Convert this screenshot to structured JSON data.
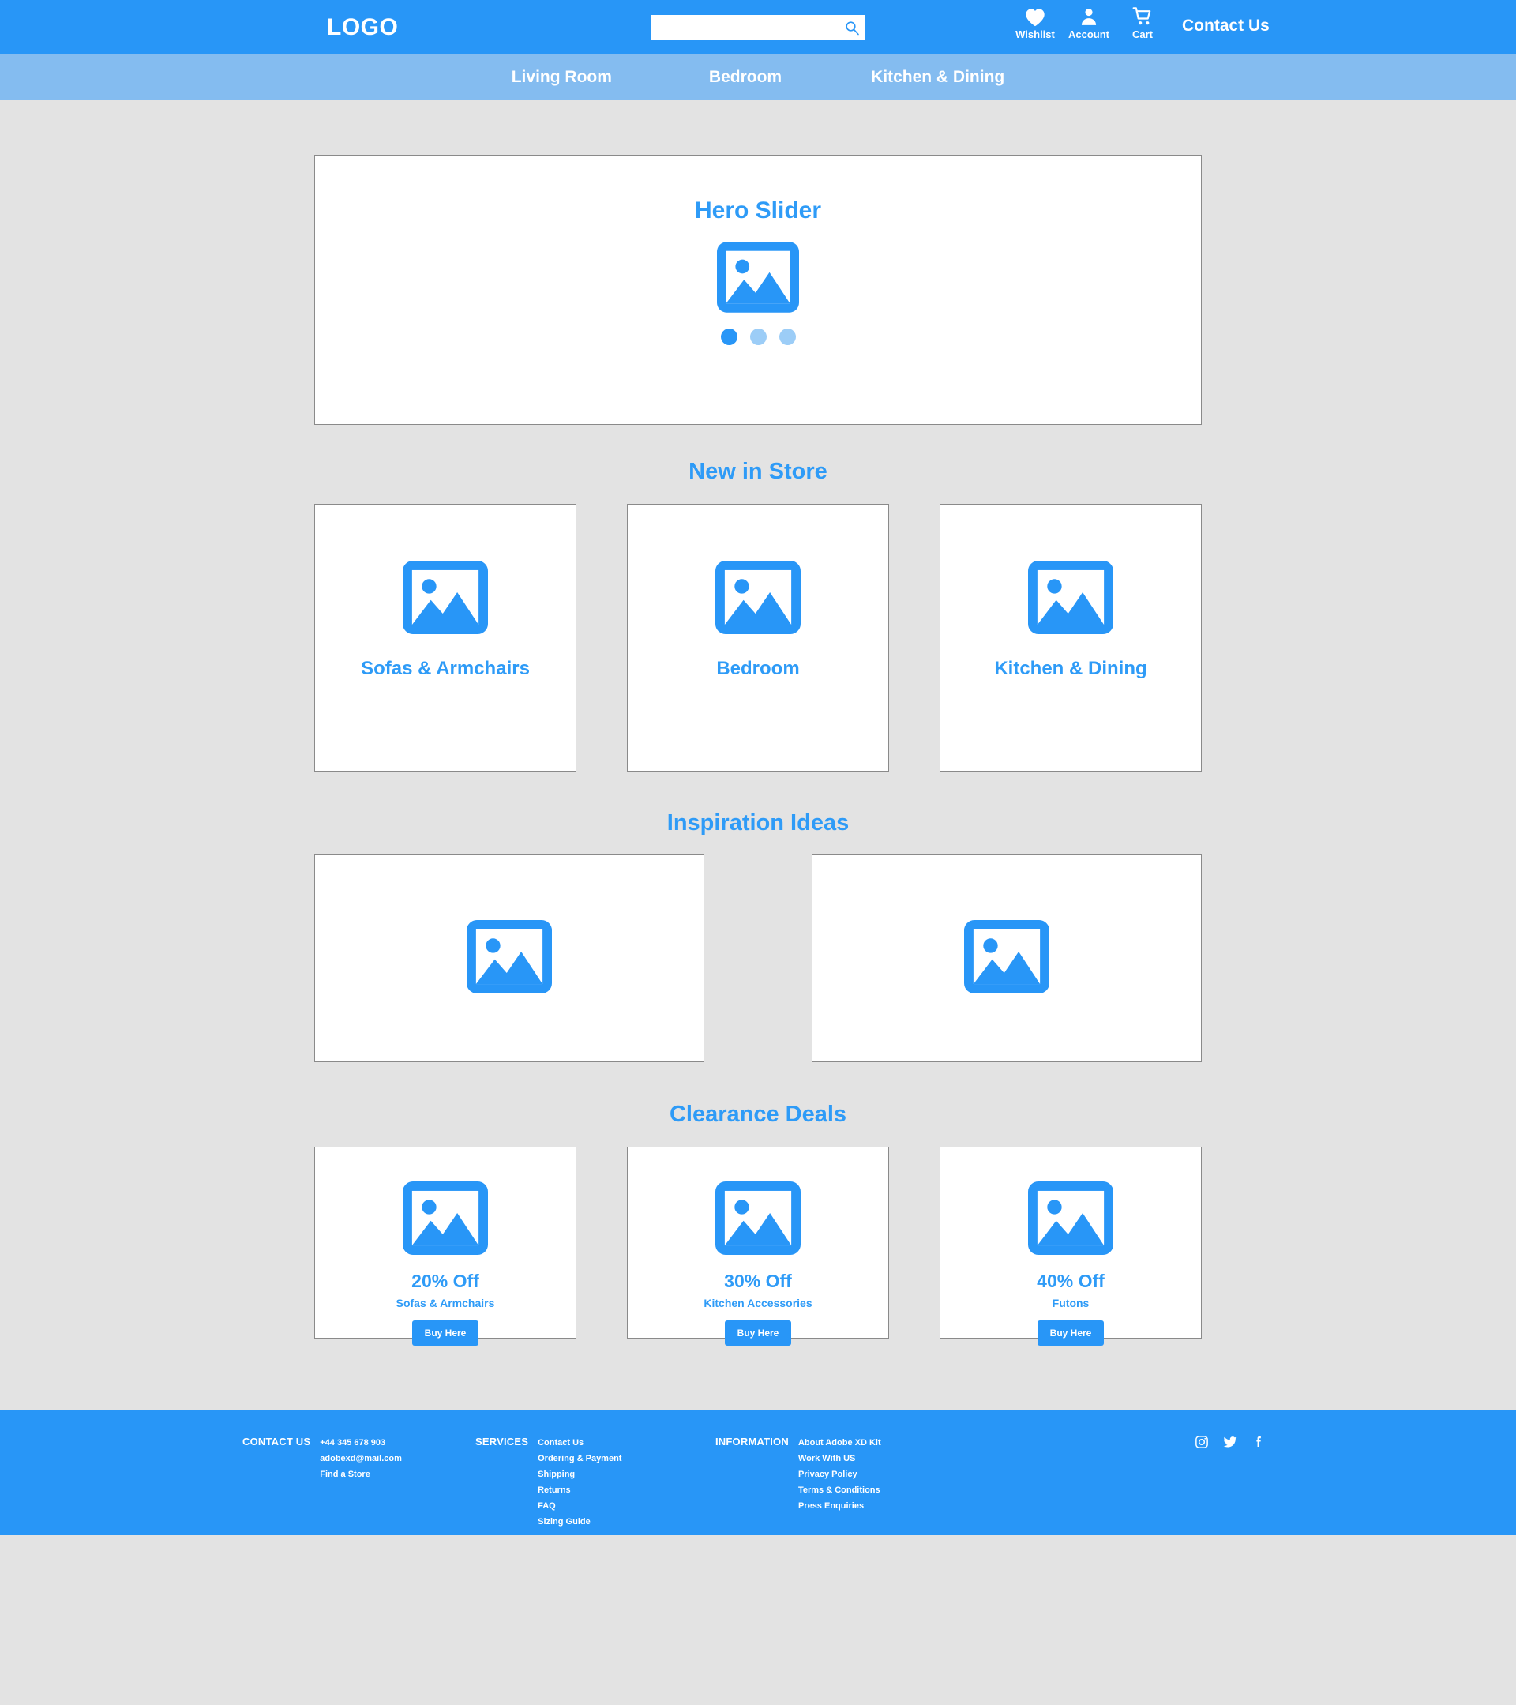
{
  "header": {
    "logo": "LOGO",
    "search": {
      "value": "",
      "placeholder": ""
    },
    "actions": [
      {
        "icon": "heart-icon",
        "label": "Wishlist"
      },
      {
        "icon": "person-icon",
        "label": "Account"
      },
      {
        "icon": "cart-icon",
        "label": "Cart"
      }
    ],
    "contact_label": "Contact Us"
  },
  "nav": {
    "items": [
      {
        "label": "Living Room"
      },
      {
        "label": "Bedroom"
      },
      {
        "label": "Kitchen & Dining"
      }
    ]
  },
  "hero": {
    "title": "Hero Slider",
    "image_icon": "image-placeholder-icon",
    "dots": [
      {
        "active": true
      },
      {
        "active": false
      },
      {
        "active": false
      }
    ]
  },
  "new_in_store": {
    "title": "New in Store",
    "cards": [
      {
        "label": "Sofas & Armchairs",
        "icon": "image-placeholder-icon"
      },
      {
        "label": "Bedroom",
        "icon": "image-placeholder-icon"
      },
      {
        "label": "Kitchen & Dining",
        "icon": "image-placeholder-icon"
      }
    ]
  },
  "inspiration": {
    "title": "Inspiration Ideas",
    "cards": [
      {
        "icon": "image-placeholder-icon"
      },
      {
        "icon": "image-placeholder-icon"
      }
    ]
  },
  "clearance": {
    "title": "Clearance Deals",
    "cards": [
      {
        "percent": "20% Off",
        "category": "Sofas & Armchairs",
        "button": "Buy Here",
        "icon": "image-placeholder-icon"
      },
      {
        "percent": "30% Off",
        "category": "Kitchen Accessories",
        "button": "Buy Here",
        "icon": "image-placeholder-icon"
      },
      {
        "percent": "40% Off",
        "category": "Futons",
        "button": "Buy Here",
        "icon": "image-placeholder-icon"
      }
    ]
  },
  "footer": {
    "contact": {
      "heading": "CONTACT US",
      "items": [
        "+44 345 678 903",
        "adobexd@mail.com",
        "Find a Store"
      ]
    },
    "services": {
      "heading": "SERVICES",
      "items": [
        "Contact Us",
        "Ordering & Payment",
        "Shipping",
        "Returns",
        "FAQ",
        "Sizing Guide"
      ]
    },
    "information": {
      "heading": "INFORMATION",
      "items": [
        "About Adobe XD Kit",
        "Work With US",
        "Privacy Policy",
        "Terms & Conditions",
        "Press Enquiries"
      ]
    },
    "socials": [
      {
        "icon": "instagram-icon"
      },
      {
        "icon": "twitter-icon"
      },
      {
        "icon": "facebook-icon"
      }
    ]
  },
  "colors": {
    "primary": "#2896f7",
    "nav": "#84bcf0",
    "accent_text": "#2e9bf7",
    "page_bg": "#e3e3e3",
    "card_bg": "#ffffff",
    "card_border": "#8a8a8a",
    "dot_inactive": "#9ccdf7"
  }
}
